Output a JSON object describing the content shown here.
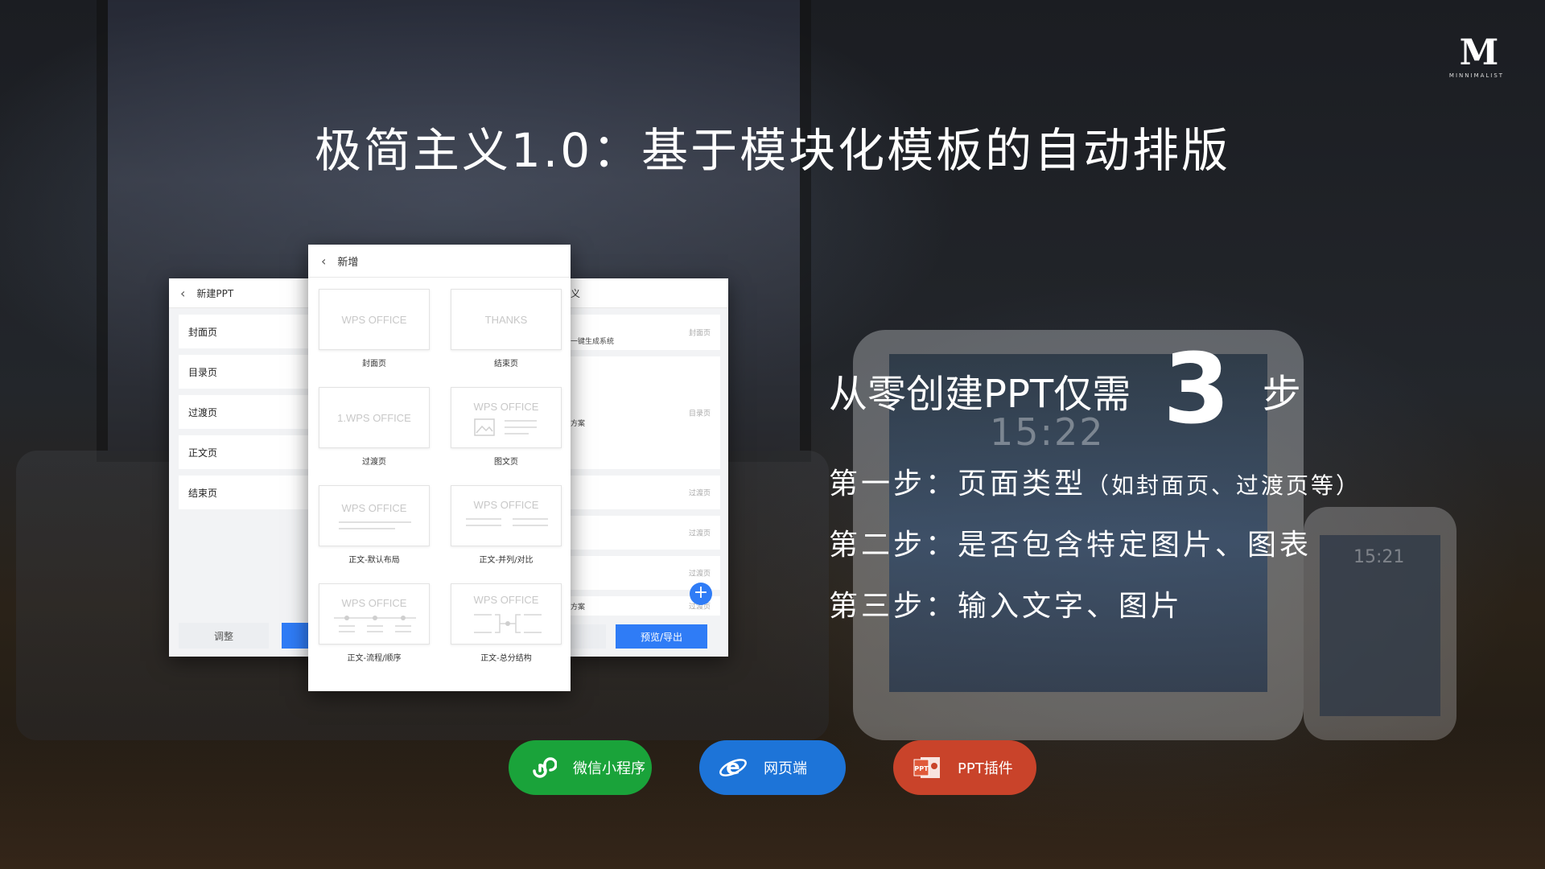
{
  "logo": {
    "mark": "M",
    "text": "MINNIMALIST"
  },
  "title": "极简主义1.0：基于模块化模板的自动排版",
  "headline": {
    "prefix": "从零创建PPT仅需",
    "number": "3",
    "suffix": "步"
  },
  "steps": [
    {
      "label": "第一步：",
      "text": "页面类型",
      "note": "（如封面页、过渡页等）"
    },
    {
      "label": "第二步：",
      "text": "是否包含特定图片、图表",
      "note": ""
    },
    {
      "label": "第三步：",
      "text": "输入文字、图片",
      "note": ""
    }
  ],
  "background": {
    "tablet_clock": "15:22",
    "phone_clock": "15:21"
  },
  "left_screen": {
    "title": "新建PPT",
    "items": [
      "封面页",
      "目录页",
      "过渡页",
      "正文页",
      "结束页"
    ],
    "adjust_label": "调整"
  },
  "mid_screen": {
    "title": "新增",
    "tiles": [
      {
        "text": "WPS OFFICE",
        "caption": "封面页"
      },
      {
        "text": "THANKS",
        "caption": "结束页"
      },
      {
        "text": "1.WPS OFFICE",
        "caption": "过渡页"
      },
      {
        "text": "WPS OFFICE",
        "caption": "图文页"
      },
      {
        "text": "WPS OFFICE",
        "caption": "正文-默认布局"
      },
      {
        "text": "WPS OFFICE",
        "caption": "正文-并列/对比"
      },
      {
        "text": "WPS OFFICE",
        "caption": "正文-流程/顺序"
      },
      {
        "text": "WPS OFFICE",
        "caption": "正文-总分结构"
      }
    ]
  },
  "right_screen": {
    "title_fragment": "义",
    "items": [
      {
        "text": "一键生成系统",
        "tag": "封面页"
      },
      {
        "text": "方案",
        "tag": "目录页"
      },
      {
        "text": "",
        "tag": "过渡页"
      },
      {
        "text": "",
        "tag": "过渡页"
      },
      {
        "text": "",
        "tag": "过渡页"
      },
      {
        "text": "方案",
        "tag": "过渡页"
      }
    ],
    "export_label": "预览/导出",
    "add_label": "+"
  },
  "platforms": [
    {
      "label": "微信小程序",
      "icon": "mini-program-icon",
      "color": "#1aa33a"
    },
    {
      "label": "网页端",
      "icon": "ie-browser-icon",
      "color": "#1d74d8"
    },
    {
      "label": "PPT插件",
      "icon": "powerpoint-icon",
      "color": "#c9432a"
    }
  ]
}
